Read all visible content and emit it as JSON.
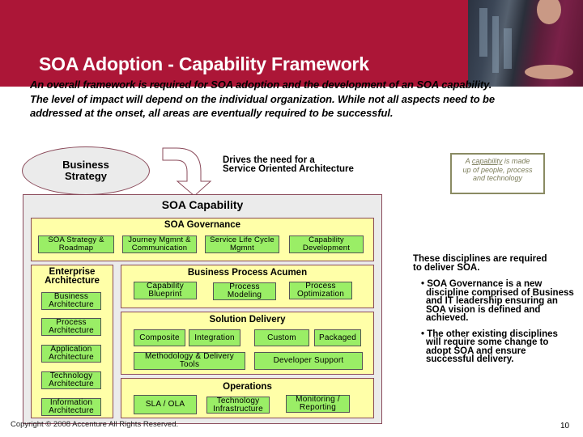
{
  "header": {
    "title": "SOA Adoption - Capability Framework",
    "accent_color": "#ac1637"
  },
  "intro": {
    "line1": "An overall framework is required for SOA adoption and the development of an SOA capability.",
    "line2": "The level of impact will depend on the individual organization.  While not all aspects need to be",
    "line3": "addressed at the onset, all areas are eventually required to be successful."
  },
  "strategy": {
    "line1": "Business",
    "line2": "Strategy"
  },
  "drives": {
    "line1": "Drives the need for a",
    "line2": "Service Oriented Architecture"
  },
  "capability_note": {
    "prefix": "A ",
    "underlined": "capability",
    "line1_rest": " is made",
    "line2": "up of people, process",
    "line3": "and technology"
  },
  "framework": {
    "title": "SOA Capability",
    "governance": {
      "title": "SOA Governance",
      "items": [
        {
          "line1": "SOA Strategy &",
          "line2": "Roadmap"
        },
        {
          "line1": "Journey Mgmnt &",
          "line2": "Communication"
        },
        {
          "line1": "Service Life Cycle",
          "line2": "Mgmnt"
        },
        {
          "line1": "Capability",
          "line2": "Development"
        }
      ]
    },
    "enterprise_architecture": {
      "title_line1": "Enterprise",
      "title_line2": "Architecture",
      "items": [
        {
          "line1": "Business",
          "line2": "Architecture"
        },
        {
          "line1": "Process",
          "line2": "Architecture"
        },
        {
          "line1": "Application",
          "line2": "Architecture"
        },
        {
          "line1": "Technology",
          "line2": "Architecture"
        },
        {
          "line1": "Information",
          "line2": "Architecture"
        }
      ]
    },
    "business_process": {
      "title": "Business Process Acumen",
      "items": [
        {
          "line1": "Capability",
          "line2": "Blueprint"
        },
        {
          "line1": "Process",
          "line2": "Modeling"
        },
        {
          "line1": "Process",
          "line2": "Optimization"
        }
      ]
    },
    "solution_delivery": {
      "title": "Solution Delivery",
      "items": [
        {
          "line1": "Composite",
          "line2": ""
        },
        {
          "line1": "Integration",
          "line2": ""
        },
        {
          "line1": "Custom",
          "line2": ""
        },
        {
          "line1": "Packaged",
          "line2": ""
        },
        {
          "line1": "Methodology & Delivery",
          "line2": "Tools"
        },
        {
          "line1": "Developer Support",
          "line2": ""
        }
      ]
    },
    "operations": {
      "title": "Operations",
      "items": [
        {
          "line1": "SLA / OLA",
          "line2": ""
        },
        {
          "line1": "Technology",
          "line2": "Infrastructure"
        },
        {
          "line1": "Monitoring /",
          "line2": "Reporting"
        }
      ]
    }
  },
  "side_text": {
    "lead_line1": "These disciplines are required",
    "lead_line2": "to deliver SOA.",
    "bullets": [
      {
        "text": "SOA Governance is a new discipline comprised of Business and IT leadership ensuring an SOA vision is defined and achieved."
      },
      {
        "text": "The other existing disciplines will require some change to adopt SOA and ensure successful delivery."
      }
    ]
  },
  "footer": {
    "copyright": "Copyright © 2008 Accenture All Rights Reserved.",
    "page_number": "10"
  }
}
